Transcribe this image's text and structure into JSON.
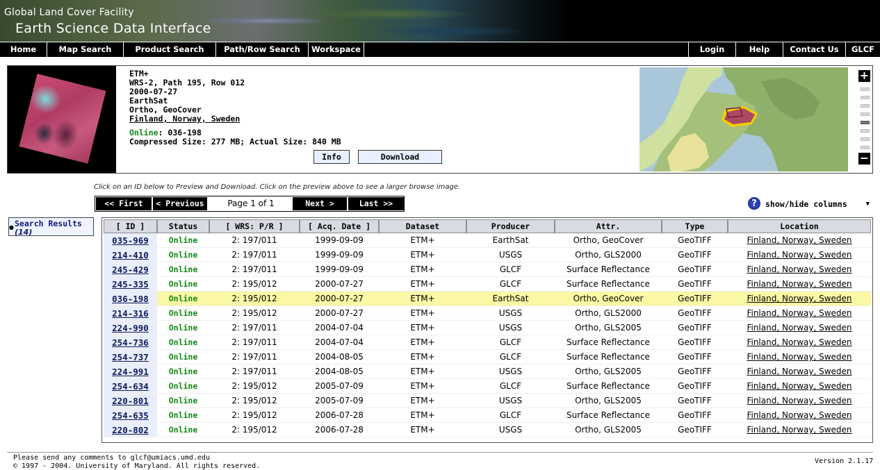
{
  "header": {
    "org_title": "Global Land Cover Facility",
    "app_title": "Earth Science Data Interface"
  },
  "nav": {
    "left": [
      {
        "label": "Home"
      },
      {
        "label": "Map Search"
      },
      {
        "label": "Product Search"
      },
      {
        "label": "Path/Row Search"
      },
      {
        "label": "Workspace"
      }
    ],
    "right": [
      {
        "label": "Login"
      },
      {
        "label": "Help"
      },
      {
        "label": "Contact Us"
      },
      {
        "label": "GLCF"
      }
    ]
  },
  "preview": {
    "sensor": "ETM+",
    "wrs": "WRS-2, Path 195, Row 012",
    "date": "2000-07-27",
    "producer": "EarthSat",
    "attr": "Ortho, GeoCover",
    "location": "Finland, Norway, Sweden",
    "status_label": "Online",
    "status_sep": ": ",
    "id": "036-198",
    "size_text": "Compressed Size: 277 MB; Actual Size: 840 MB",
    "info_button": "Info",
    "download_button": "Download"
  },
  "zoom": {
    "plus": "+",
    "minus": "−"
  },
  "instruction": "Click on an ID below to Preview and Download. Click on the preview above to see a larger browse image.",
  "pager": {
    "first": "<< First",
    "previous": "< Previous",
    "page_label": "Page 1 of 1",
    "next": "Next >",
    "last": "Last >>"
  },
  "help_icon": "?",
  "columns_toggle": "show/hide columns",
  "sidebar": {
    "label": "Search Results",
    "count": "(14)"
  },
  "table": {
    "columns": [
      "[ ID ]",
      "Status",
      "[ WRS: P/R ]",
      "[ Acq. Date ]",
      "Dataset",
      "Producer",
      "Attr.",
      "Type",
      "Location"
    ],
    "selected_id": "036-198",
    "rows": [
      {
        "id": "035-969",
        "status": "Online",
        "wrs": "2: 197/011",
        "date": "1999-09-09",
        "dataset": "ETM+",
        "producer": "EarthSat",
        "attr": "Ortho, GeoCover",
        "type": "GeoTIFF",
        "location": "Finland, Norway, Sweden"
      },
      {
        "id": "214-410",
        "status": "Online",
        "wrs": "2: 197/011",
        "date": "1999-09-09",
        "dataset": "ETM+",
        "producer": "USGS",
        "attr": "Ortho, GLS2000",
        "type": "GeoTIFF",
        "location": "Finland, Norway, Sweden"
      },
      {
        "id": "245-429",
        "status": "Online",
        "wrs": "2: 197/011",
        "date": "1999-09-09",
        "dataset": "ETM+",
        "producer": "GLCF",
        "attr": "Surface Reflectance",
        "type": "GeoTIFF",
        "location": "Finland, Norway, Sweden"
      },
      {
        "id": "245-335",
        "status": "Online",
        "wrs": "2: 195/012",
        "date": "2000-07-27",
        "dataset": "ETM+",
        "producer": "GLCF",
        "attr": "Surface Reflectance",
        "type": "GeoTIFF",
        "location": "Finland, Norway, Sweden"
      },
      {
        "id": "036-198",
        "status": "Online",
        "wrs": "2: 195/012",
        "date": "2000-07-27",
        "dataset": "ETM+",
        "producer": "EarthSat",
        "attr": "Ortho, GeoCover",
        "type": "GeoTIFF",
        "location": "Finland, Norway, Sweden"
      },
      {
        "id": "214-316",
        "status": "Online",
        "wrs": "2: 195/012",
        "date": "2000-07-27",
        "dataset": "ETM+",
        "producer": "USGS",
        "attr": "Ortho, GLS2000",
        "type": "GeoTIFF",
        "location": "Finland, Norway, Sweden"
      },
      {
        "id": "224-990",
        "status": "Online",
        "wrs": "2: 197/011",
        "date": "2004-07-04",
        "dataset": "ETM+",
        "producer": "USGS",
        "attr": "Ortho, GLS2005",
        "type": "GeoTIFF",
        "location": "Finland, Norway, Sweden"
      },
      {
        "id": "254-736",
        "status": "Online",
        "wrs": "2: 197/011",
        "date": "2004-07-04",
        "dataset": "ETM+",
        "producer": "GLCF",
        "attr": "Surface Reflectance",
        "type": "GeoTIFF",
        "location": "Finland, Norway, Sweden"
      },
      {
        "id": "254-737",
        "status": "Online",
        "wrs": "2: 197/011",
        "date": "2004-08-05",
        "dataset": "ETM+",
        "producer": "GLCF",
        "attr": "Surface Reflectance",
        "type": "GeoTIFF",
        "location": "Finland, Norway, Sweden"
      },
      {
        "id": "224-991",
        "status": "Online",
        "wrs": "2: 197/011",
        "date": "2004-08-05",
        "dataset": "ETM+",
        "producer": "USGS",
        "attr": "Ortho, GLS2005",
        "type": "GeoTIFF",
        "location": "Finland, Norway, Sweden"
      },
      {
        "id": "254-634",
        "status": "Online",
        "wrs": "2: 195/012",
        "date": "2005-07-09",
        "dataset": "ETM+",
        "producer": "GLCF",
        "attr": "Surface Reflectance",
        "type": "GeoTIFF",
        "location": "Finland, Norway, Sweden"
      },
      {
        "id": "220-801",
        "status": "Online",
        "wrs": "2: 195/012",
        "date": "2005-07-09",
        "dataset": "ETM+",
        "producer": "USGS",
        "attr": "Ortho, GLS2005",
        "type": "GeoTIFF",
        "location": "Finland, Norway, Sweden"
      },
      {
        "id": "254-635",
        "status": "Online",
        "wrs": "2: 195/012",
        "date": "2006-07-28",
        "dataset": "ETM+",
        "producer": "GLCF",
        "attr": "Surface Reflectance",
        "type": "GeoTIFF",
        "location": "Finland, Norway, Sweden"
      },
      {
        "id": "220-802",
        "status": "Online",
        "wrs": "2: 195/012",
        "date": "2006-07-28",
        "dataset": "ETM+",
        "producer": "USGS",
        "attr": "Ortho, GLS2005",
        "type": "GeoTIFF",
        "location": "Finland, Norway, Sweden"
      }
    ]
  },
  "footer": {
    "comments": "Please send any comments to glcf@umiacs.umd.edu",
    "copyright": "© 1997 - 2004. University of Maryland. All rights reserved.",
    "version": "Version 2.1.17"
  },
  "colors": {
    "online": "#118811",
    "selected_row": "#fbf8a6",
    "id_cell": "#e9eefc",
    "header_cell": "#d9dbe2",
    "nav_bg": "#000000"
  }
}
